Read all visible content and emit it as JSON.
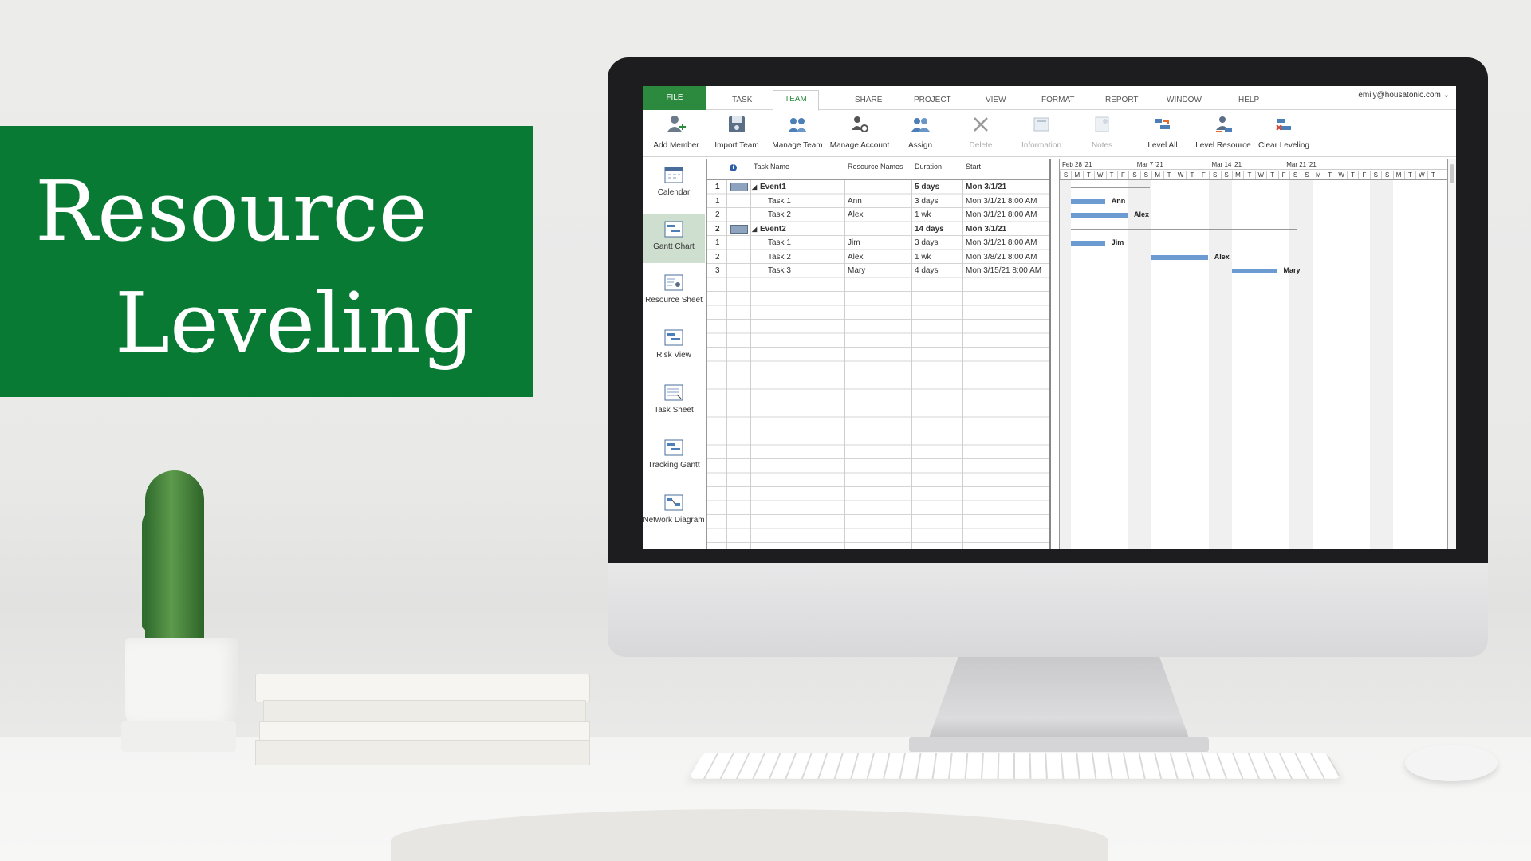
{
  "banner": {
    "line1": "Resource",
    "line2": "Leveling",
    "color": "#087a34"
  },
  "app": {
    "account": "emily@housatonic.com ⌄",
    "tabs": [
      "FILE",
      "TASK",
      "TEAM",
      "SHARE",
      "PROJECT",
      "VIEW",
      "FORMAT",
      "REPORT",
      "WINDOW",
      "HELP"
    ],
    "active_tab": "TEAM",
    "ribbon": [
      {
        "label": "Add Member",
        "icon": "add-member-icon"
      },
      {
        "label": "Import Team",
        "icon": "import-team-icon"
      },
      {
        "label": "Manage Team",
        "icon": "manage-team-icon"
      },
      {
        "label": "Manage Account",
        "icon": "manage-account-icon"
      },
      {
        "label": "Assign",
        "icon": "assign-icon"
      },
      {
        "label": "Delete",
        "icon": "delete-icon"
      },
      {
        "label": "Information",
        "icon": "information-icon"
      },
      {
        "label": "Notes",
        "icon": "notes-icon"
      },
      {
        "label": "Level All",
        "icon": "level-all-icon"
      },
      {
        "label": "Level Resource",
        "icon": "level-resource-icon"
      },
      {
        "label": "Clear Leveling",
        "icon": "clear-leveling-icon"
      }
    ],
    "sidebar": [
      {
        "label": "Calendar"
      },
      {
        "label": "Gantt Chart"
      },
      {
        "label": "Resource Sheet"
      },
      {
        "label": "Risk View"
      },
      {
        "label": "Task Sheet"
      },
      {
        "label": "Tracking Gantt"
      },
      {
        "label": "Network Diagram"
      }
    ],
    "columns": {
      "task_name": "Task Name",
      "resource_names": "Resource Names",
      "duration": "Duration",
      "start": "Start",
      "info_icon": "i"
    },
    "rows": [
      {
        "id": "1",
        "name": "Event1",
        "resource": "",
        "duration": "5 days",
        "start": "Mon 3/1/21",
        "summary": true
      },
      {
        "id": "1",
        "name": "Task 1",
        "resource": "Ann",
        "duration": "3 days",
        "start": "Mon 3/1/21 8:00 AM",
        "summary": false
      },
      {
        "id": "2",
        "name": "Task 2",
        "resource": "Alex",
        "duration": "1 wk",
        "start": "Mon 3/1/21 8:00 AM",
        "summary": false
      },
      {
        "id": "2",
        "name": "Event2",
        "resource": "",
        "duration": "14 days",
        "start": "Mon 3/1/21",
        "summary": true
      },
      {
        "id": "1",
        "name": "Task 1",
        "resource": "Jim",
        "duration": "3 days",
        "start": "Mon 3/1/21 8:00 AM",
        "summary": false
      },
      {
        "id": "2",
        "name": "Task 2",
        "resource": "Alex",
        "duration": "1 wk",
        "start": "Mon 3/8/21 8:00 AM",
        "summary": false
      },
      {
        "id": "3",
        "name": "Task 3",
        "resource": "Mary",
        "duration": "4 days",
        "start": "Mon 3/15/21 8:00 AM",
        "summary": false
      }
    ],
    "gantt": {
      "weeks": [
        "Feb 28 '21",
        "Mar 7 '21",
        "Mar 14 '21",
        "Mar 21 '21"
      ],
      "day_letters": [
        "S",
        "M",
        "T",
        "W",
        "T",
        "F",
        "S"
      ],
      "bars": [
        {
          "row": 1,
          "label": "Ann"
        },
        {
          "row": 2,
          "label": "Alex"
        },
        {
          "row": 4,
          "label": "Jim"
        },
        {
          "row": 5,
          "label": "Alex"
        },
        {
          "row": 6,
          "label": "Mary"
        }
      ],
      "bar_color": "#6c9bd2"
    }
  }
}
